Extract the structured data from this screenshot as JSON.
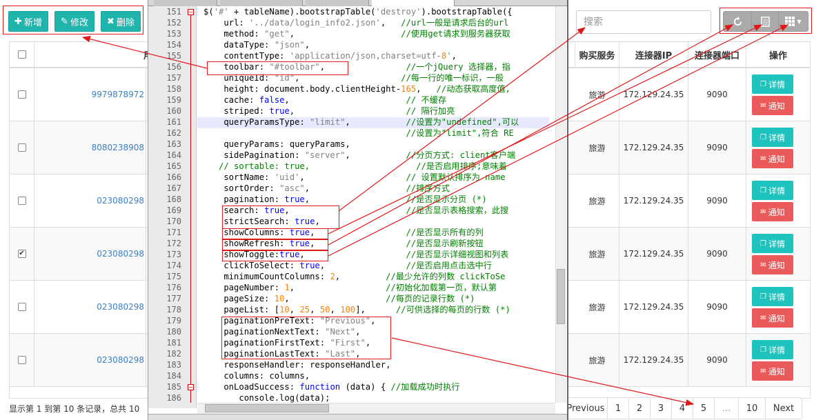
{
  "toolbar": {
    "add_label": "新增",
    "edit_label": "修改",
    "delete_label": "删除"
  },
  "search": {
    "placeholder": "搜索"
  },
  "table": {
    "headers": [
      "用户编",
      "购买服务",
      "连接器IP",
      "连接器端口",
      "操作"
    ],
    "rows": [
      {
        "uid": "9979878972",
        "service": "旅游",
        "ip": "172.129.24.35",
        "port": "9090",
        "checked": false
      },
      {
        "uid": "8080238908",
        "service": "旅游",
        "ip": "172.129.24.35",
        "port": "9090",
        "checked": false
      },
      {
        "uid": "023080298",
        "service": "旅游",
        "ip": "172.129.24.35",
        "port": "9090",
        "checked": false
      },
      {
        "uid": "023080298",
        "service": "旅游",
        "ip": "172.129.24.35",
        "port": "9090",
        "checked": true
      },
      {
        "uid": "023080298",
        "service": "旅游",
        "ip": "172.129.24.35",
        "port": "9090",
        "checked": false
      },
      {
        "uid": "023080298",
        "service": "旅游",
        "ip": "172.129.24.35",
        "port": "9090",
        "checked": false
      }
    ],
    "detail_label": "详情",
    "notify_label": "通知",
    "check_mark": "✔"
  },
  "footer": {
    "summary": "显示第 1 到第 10 条记录，总共 10"
  },
  "pager": {
    "previous": "Previous",
    "pages": [
      "1",
      "2",
      "3",
      "4",
      "5",
      "…",
      "10"
    ],
    "next": "Next"
  },
  "editor": {
    "lines": [
      {
        "n": "151",
        "code": "$('#' + tableName).bootstrapTable('destroy').bootstrapTable({"
      },
      {
        "n": "152",
        "code": "    url: '../data/login_info2.json',   //url一般是请求后台的url"
      },
      {
        "n": "153",
        "code": "    method: \"get\",                     //使用get请求到服务器获取"
      },
      {
        "n": "154",
        "code": "    dataType: \"json\","
      },
      {
        "n": "155",
        "code": "    contentType: 'application/json,charset=utf-8',"
      },
      {
        "n": "156",
        "code": "    toolbar: \"#toolbar\",                //一个jQuery 选择器，指"
      },
      {
        "n": "157",
        "code": "    uniqueId: \"id\",                    //每一行的唯一标识，一般"
      },
      {
        "n": "158",
        "code": "    height: document.body.clientHeight-165,   //动态获取高度值,"
      },
      {
        "n": "159",
        "code": "    cache: false,                       // 不缓存"
      },
      {
        "n": "160",
        "code": "    striped: true,                      // 隔行加亮"
      },
      {
        "n": "161",
        "code": "    queryParamsType: \"limit\",           //设置为\"undefined\",可以"
      },
      {
        "n": "162",
        "code": "                                        //设置为\"limit\",符合 RE"
      },
      {
        "n": "163",
        "code": "    queryParams: queryParams,"
      },
      {
        "n": "164",
        "code": "    sidePagination: \"server\",           //分页方式: client客户端"
      },
      {
        "n": "165",
        "code": "   // sortable: true,                     //是否启用排序;意味着"
      },
      {
        "n": "166",
        "code": "    sortName: 'uid',                    // 设置默认排序为 name"
      },
      {
        "n": "167",
        "code": "    sortOrder: \"asc\",                   //排序方式"
      },
      {
        "n": "168",
        "code": "    pagination: true,                   //是否显示分页 (*)"
      },
      {
        "n": "169",
        "code": "    search: true,                       //是否显示表格搜索，此搜"
      },
      {
        "n": "170",
        "code": "    strictSearch: true,"
      },
      {
        "n": "171",
        "code": "    showColumns: true,                  //是否显示所有的列"
      },
      {
        "n": "172",
        "code": "    showRefresh: true,                  //是否显示刷新按钮"
      },
      {
        "n": "173",
        "code": "    showToggle:true,                    //是否显示详细视图和列表"
      },
      {
        "n": "174",
        "code": "    clickToSelect: true,                //是否启用点击选中行"
      },
      {
        "n": "175",
        "code": "    minimumCountColumns: 2,         //最少允许的列数 clickToSe"
      },
      {
        "n": "176",
        "code": "    pageNumber: 1,                  //初始化加载第一页，默认第"
      },
      {
        "n": "177",
        "code": "    pageSize: 10,                   //每页的记录行数 (*)"
      },
      {
        "n": "178",
        "code": "    pageList: [10, 25, 50, 100],      //可供选择的每页的行数 (*)"
      },
      {
        "n": "179",
        "code": "    paginationPreText: \"Previous\","
      },
      {
        "n": "180",
        "code": "    paginationNextText: \"Next\","
      },
      {
        "n": "181",
        "code": "    paginationFirstText: \"First\","
      },
      {
        "n": "182",
        "code": "    paginationLastText: \"Last\","
      },
      {
        "n": "183",
        "code": "    responseHandler: responseHandler,"
      },
      {
        "n": "184",
        "code": "    columns: columns,"
      },
      {
        "n": "185",
        "code": "    onLoadSuccess: function (data) { //加载成功时执行"
      },
      {
        "n": "186",
        "code": "       console.log(data);"
      }
    ]
  },
  "colors": {
    "teal": "#1fb5ac",
    "red": "#ea5a5a",
    "annotation": "#e01818",
    "link": "#3b7fc4"
  }
}
